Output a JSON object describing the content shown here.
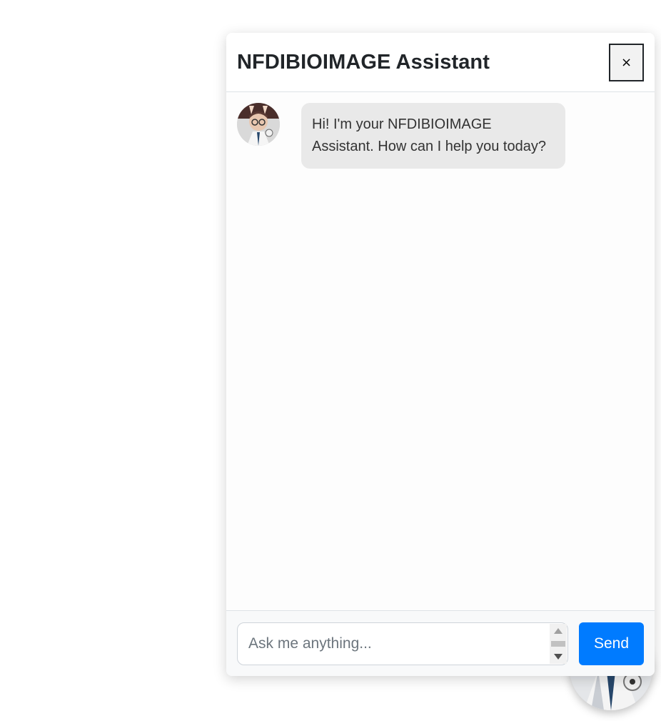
{
  "header": {
    "title": "NFDIBIOIMAGE Assistant",
    "close_label": "×"
  },
  "messages": [
    {
      "sender": "bot",
      "avatar_icon": "assistant-avatar-icon",
      "text": "Hi! I'm your NFDIBIOIMAGE Assistant. How can I help you today?"
    }
  ],
  "composer": {
    "value": "",
    "placeholder": "Ask me anything...",
    "send_label": "Send"
  },
  "launcher": {
    "avatar_icon": "assistant-avatar-icon"
  },
  "colors": {
    "accent": "#007bff",
    "bubble_bg": "#e9e9e9",
    "header_text": "#212529"
  }
}
